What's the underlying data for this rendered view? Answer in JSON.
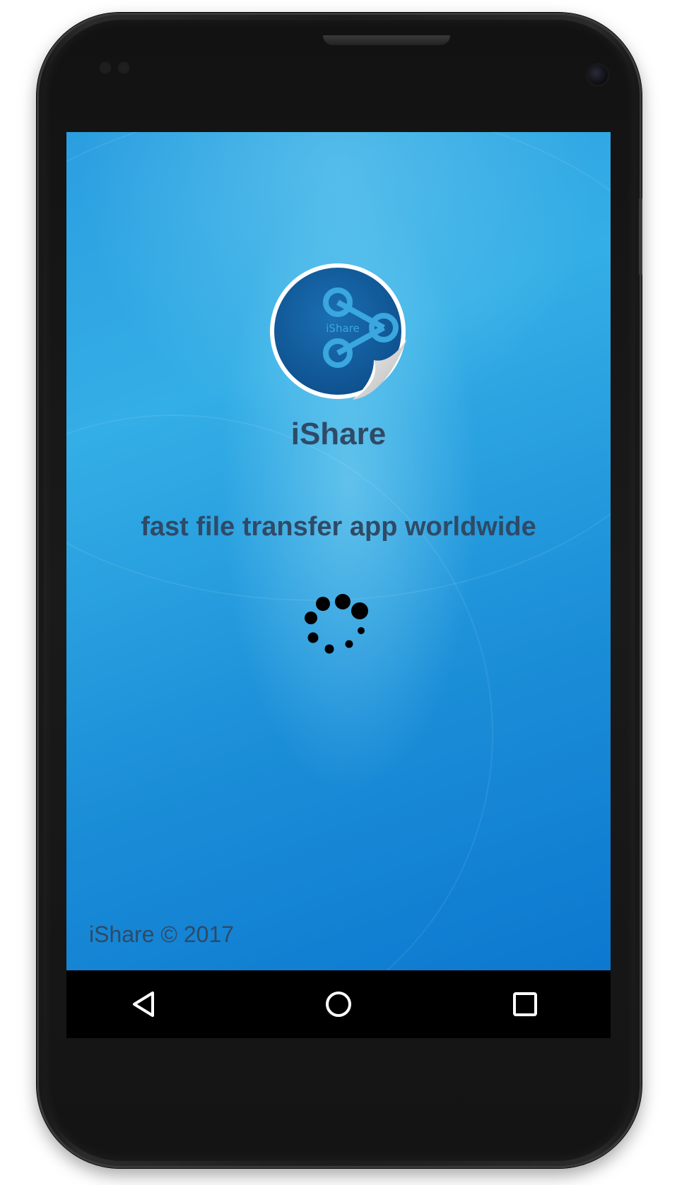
{
  "app": {
    "name": "iShare",
    "tagline": "fast file transfer app worldwide",
    "copyright": "iShare © 2017",
    "logo_text": "iShare"
  },
  "icons": {
    "logo": "share-sticker-icon",
    "loading": "loading-spinner-icon",
    "back": "back-triangle-icon",
    "home": "home-circle-icon",
    "recents": "recents-square-icon"
  },
  "colors": {
    "screen_background": "#1c8fd8",
    "text": "#2f4a66",
    "logo_blue": "#1565a6",
    "logo_accent": "#4bb6e6",
    "navbar": "#000000"
  }
}
